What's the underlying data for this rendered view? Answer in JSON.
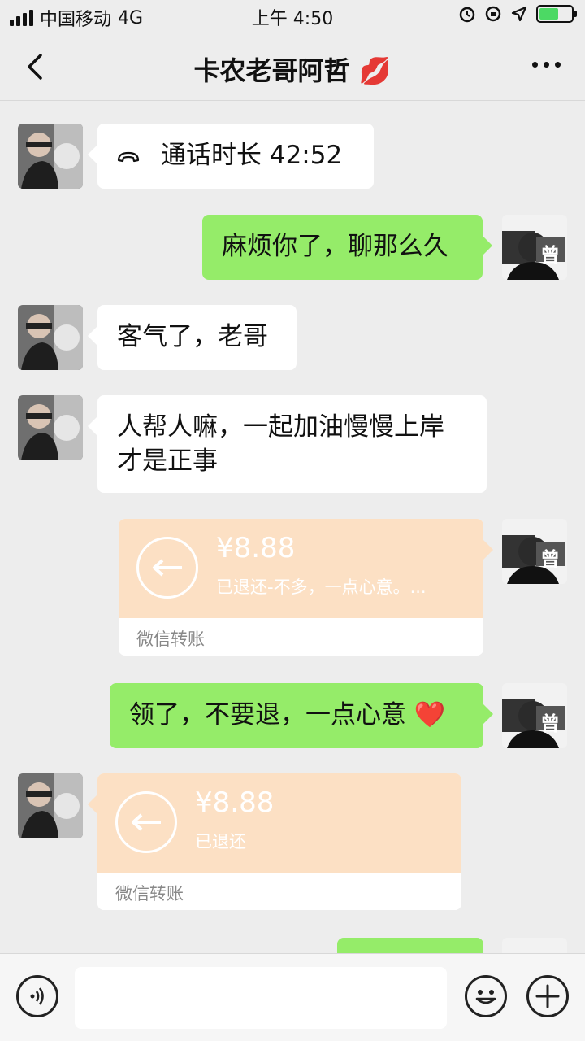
{
  "status_bar": {
    "carrier": "中国移动",
    "network": "4G",
    "time": "上午 4:50"
  },
  "nav": {
    "title": "卡农老哥阿哲",
    "title_emoji": "💋"
  },
  "messages": {
    "call": {
      "text": "通话时长 42:52"
    },
    "m1": {
      "text": "麻烦你了，聊那么久"
    },
    "m2": {
      "text": "客气了，老哥"
    },
    "m3": {
      "line1": "人帮人嘛，一起加油慢慢上岸",
      "line2": "才是正事"
    },
    "t1": {
      "amount": "¥8.88",
      "note": "已退还-不多，一点心意。...",
      "footer": "微信转账"
    },
    "m4": {
      "text": "领了，不要退，一点心意",
      "emoji": "❤️"
    },
    "t2": {
      "amount": "¥8.88",
      "note": "已退还",
      "footer": "微信转账"
    }
  },
  "avatar_label": "曾",
  "colors": {
    "bg": "#ededed",
    "outgoing_bubble": "#95ec69",
    "incoming_bubble": "#ffffff",
    "transfer_bg": "#fce0c4"
  }
}
